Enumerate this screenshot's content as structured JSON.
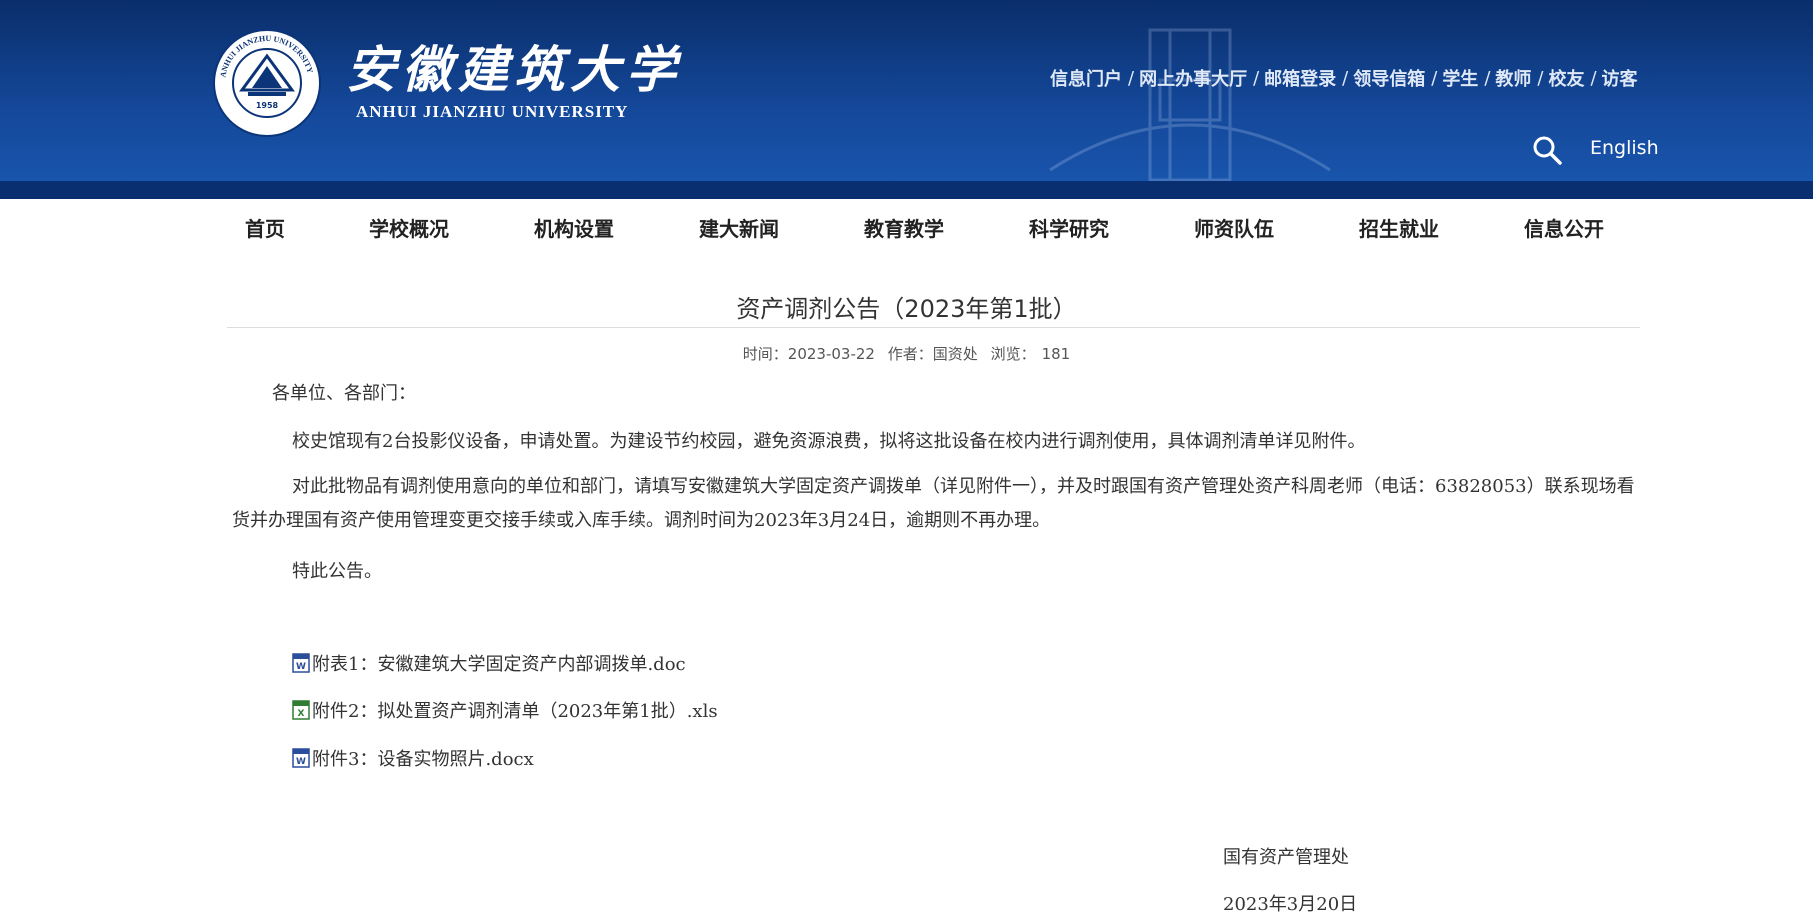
{
  "header": {
    "logo_cn": "安徽建筑大学",
    "logo_en": "ANHUI JIANZHU UNIVERSITY",
    "seal_year": "1958",
    "seal_ring_text": "ANHUI JIANZHU UNIVERSITY",
    "quick_links": [
      "信息门户",
      "网上办事大厅",
      "邮箱登录",
      "领导信箱",
      "学生",
      "教师",
      "校友",
      "访客"
    ],
    "quick_sep": "/",
    "english": "English",
    "brand_color": "#14489a"
  },
  "nav": {
    "items": [
      "首页",
      "学校概况",
      "机构设置",
      "建大新闻",
      "教育教学",
      "科学研究",
      "师资队伍",
      "招生就业",
      "信息公开"
    ]
  },
  "article": {
    "title": "资产调剂公告（2023年第1批）",
    "meta": {
      "time_label": "时间：",
      "time": "2023-03-22",
      "author_label": "作者：",
      "author": "国资处",
      "views_label": "浏览：",
      "views": "181"
    },
    "salutation": "各单位、各部门：",
    "para1": "校史馆现有2台投影仪设备，申请处置。为建设节约校园，避免资源浪费，拟将这批设备在校内进行调剂使用，具体调剂清单详见附件。",
    "para2": "对此批物品有调剂使用意向的单位和部门，请填写安徽建筑大学固定资产调拨单（详见附件一），并及时跟国有资产管理处资产科周老师（电话：63828053）联系现场看货并办理国有资产使用管理变更交接手续或入库手续。调剂时间为2023年3月24日，逾期则不再办理。",
    "para3": "特此公告。",
    "attachments": [
      {
        "label": "附表1：安徽建筑大学固定资产内部调拨单.doc",
        "icon": "word-doc-icon"
      },
      {
        "label": "附件2：拟处置资产调剂清单（2023年第1批）.xls",
        "icon": "excel-xls-icon"
      },
      {
        "label": "附件3：设备实物照片.docx",
        "icon": "word-doc-icon"
      }
    ],
    "signature_org": "国有资产管理处",
    "signature_date": "2023年3月20日"
  }
}
